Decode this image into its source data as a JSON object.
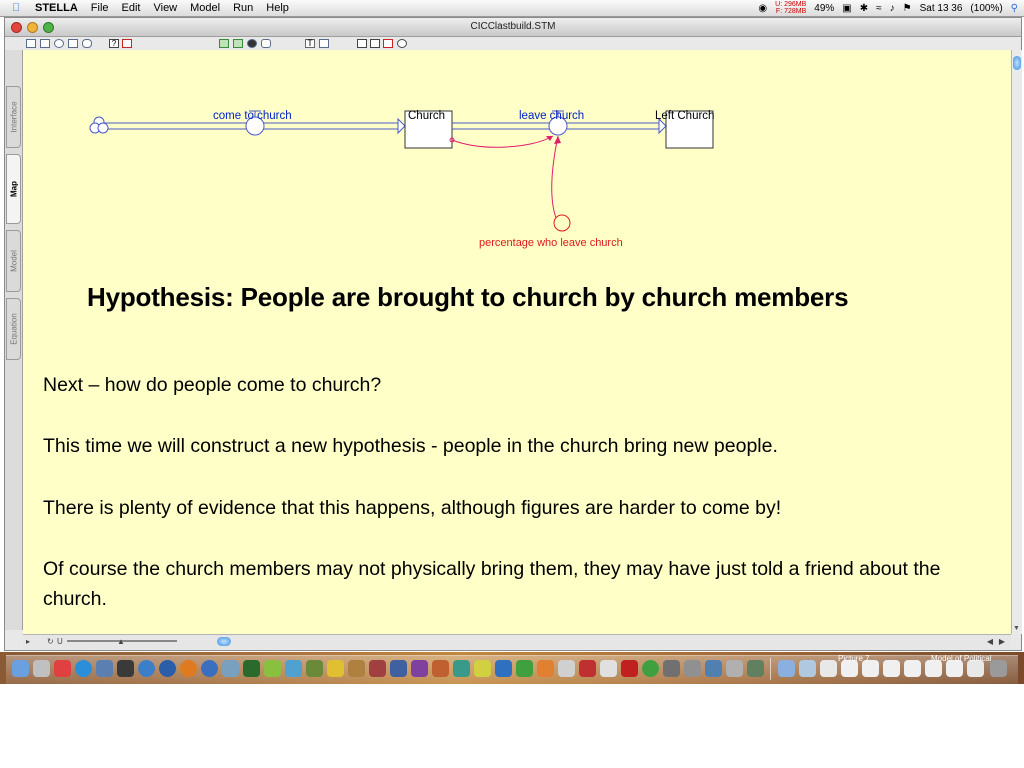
{
  "menubar": {
    "app_name": "STELLA",
    "menus": [
      "File",
      "Edit",
      "View",
      "Model",
      "Run",
      "Help"
    ],
    "memory_used": "296MB",
    "memory_free": "728MB",
    "cpu": "49%",
    "clock": "Sat 13 36",
    "battery": "(100%)"
  },
  "window": {
    "title": "CICClastbuild.STM"
  },
  "side_tabs": [
    "Interface",
    "Map",
    "Model",
    "Equation"
  ],
  "active_tab": "Map",
  "map": {
    "flow_in_label": "come to church",
    "stock_church": "Church",
    "flow_out_label": "leave church",
    "stock_left": "Left Church",
    "converter_label": "percentage who leave church"
  },
  "slide": {
    "hypothesis": "Hypothesis: People are brought to church by church members",
    "paragraphs": [
      "Next – how do people come to church?",
      "This time we will construct a new hypothesis  - people in the church bring new people.",
      "There is plenty of evidence that this happens, although figures are harder to come by!",
      "Of course the church members may not physically bring them, they may have just told a friend about the church."
    ]
  },
  "dock": {
    "label_1": "Picture 7",
    "label_2": "Model of Political"
  },
  "colors": {
    "canvas": "#ffffc8",
    "flow_blue": "#0022cc",
    "converter_red": "#dd1a1a",
    "connector_pink": "#e0206a"
  }
}
